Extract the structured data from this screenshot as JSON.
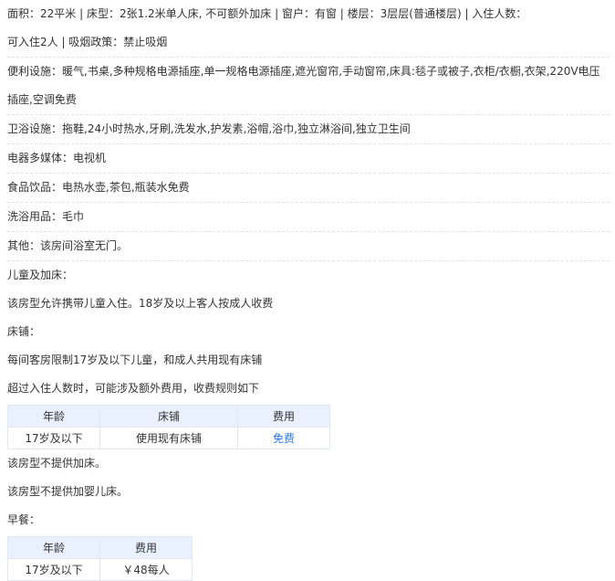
{
  "info": {
    "line1": "面积：22平米 | 床型：2张1.2米单人床, 不可额外加床 | 窗户：有窗 | 楼层：3层层(普通楼层) | 入住人数：",
    "line2": "可入住2人 | 吸烟政策：禁止吸烟"
  },
  "facilities": [
    {
      "label": "便利设施：",
      "value": "暖气,书桌,多种规格电源插座,单一规格电源插座,遮光窗帘,手动窗帘,床具:毯子或被子,衣柜/衣橱,衣架,220V电压插座,空调免费"
    },
    {
      "label": "卫浴设施：",
      "value": "拖鞋,24小时热水,牙刷,洗发水,护发素,浴帽,浴巾,独立淋浴间,独立卫生间"
    },
    {
      "label": "电器多媒体：",
      "value": "电视机"
    },
    {
      "label": "食品饮品：",
      "value": "电热水壶,茶包,瓶装水免费"
    },
    {
      "label": "洗浴用品：",
      "value": "毛巾"
    },
    {
      "label": "其他：",
      "value": "该房间浴室无门。"
    }
  ],
  "children": {
    "title": "儿童及加床：",
    "desc": "该房型允许携带儿童入住。18岁及以上客人按成人收费",
    "bed_title": "床铺：",
    "bed_desc": "每间客房限制17岁及以下儿童，和成人共用现有床铺",
    "extra_desc": "超过入住人数时，可能涉及额外费用，收费规则如下",
    "table": {
      "headers": [
        "年龄",
        "床铺",
        "费用"
      ],
      "rows": [
        [
          "17岁及以下",
          "使用现有床铺",
          "免费"
        ]
      ]
    },
    "no_extra_bed": "该房型不提供加床。",
    "no_crib": "该房型不提供加婴儿床。"
  },
  "breakfast": {
    "title": "早餐：",
    "table": {
      "headers": [
        "年龄",
        "费用"
      ],
      "rows": [
        [
          "17岁及以下",
          "￥48每人"
        ]
      ]
    }
  },
  "colors": {
    "free": "#2a7ae2",
    "header_bg": "#e8f1fd"
  }
}
